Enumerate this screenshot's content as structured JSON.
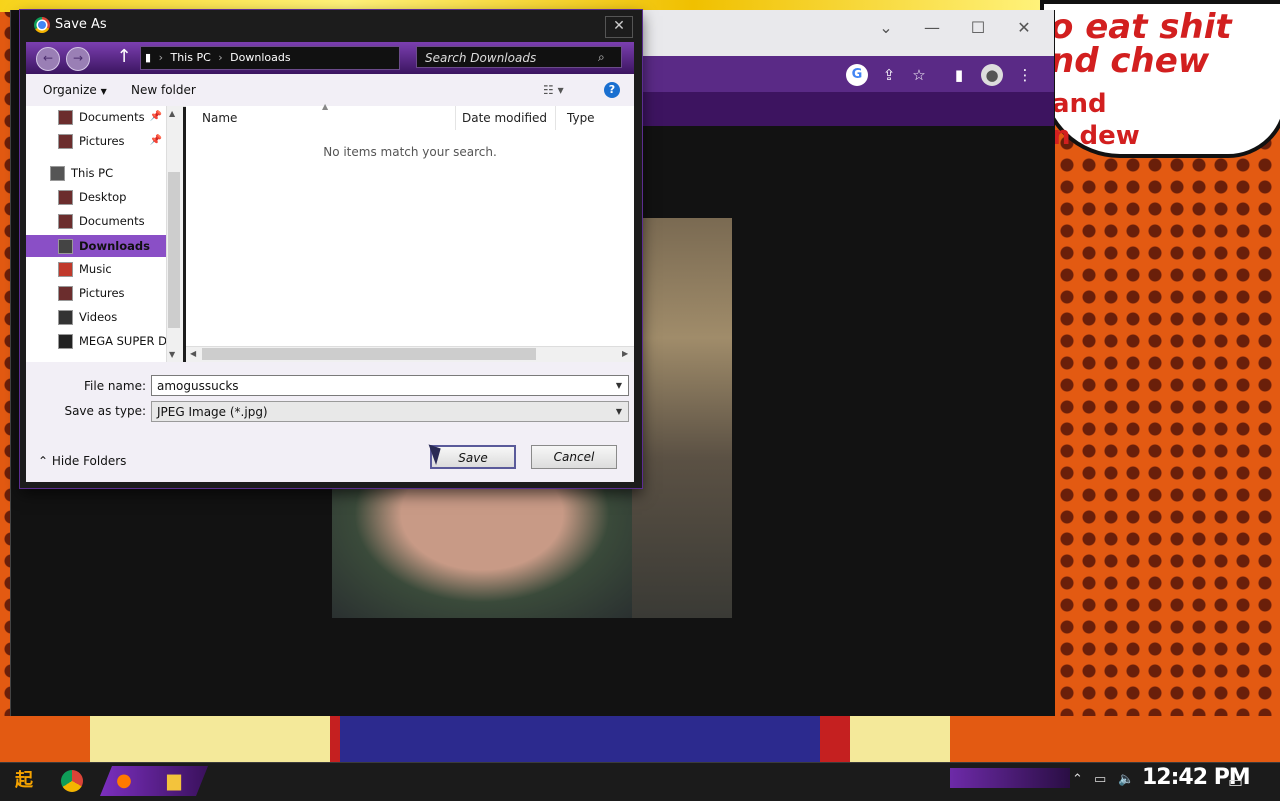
{
  "background": {
    "speech_bubble_lines": [
      "o eat shit",
      "nd chew"
    ],
    "speech_bubble_lines_back": [
      "and",
      "n dew"
    ]
  },
  "browser": {
    "window_controls": {
      "minimize": "—",
      "maximize": "☐",
      "close": "✕",
      "tab_menu": "⌄"
    },
    "toolbar_icons": [
      "google-icon",
      "share-icon",
      "star-icon",
      "sidebar-icon",
      "profile-icon",
      "menu-icon"
    ]
  },
  "dialog": {
    "title": "Save As",
    "close_label": "✕",
    "address": {
      "segments": [
        "This PC",
        "Downloads"
      ]
    },
    "search_placeholder": "Search Downloads",
    "commands": {
      "organize": "Organize",
      "new_folder": "New folder"
    },
    "nav_pane": [
      {
        "label": "Documents",
        "pinned": true
      },
      {
        "label": "Pictures",
        "pinned": true
      },
      {
        "label": "This PC",
        "pinned": false
      },
      {
        "label": "Desktop",
        "pinned": false
      },
      {
        "label": "Documents",
        "pinned": false
      },
      {
        "label": "Downloads",
        "pinned": false,
        "selected": true
      },
      {
        "label": "Music",
        "pinned": false
      },
      {
        "label": "Pictures",
        "pinned": false
      },
      {
        "label": "Videos",
        "pinned": false
      },
      {
        "label": "MEGA SUPER DU",
        "pinned": false
      }
    ],
    "columns": [
      "Name",
      "Date modified",
      "Type"
    ],
    "empty_message": "No items match your search.",
    "file_name_label": "File name:",
    "file_name_value": "amogussucks",
    "save_as_type_label": "Save as type:",
    "save_as_type_value": "JPEG Image (*.jpg)",
    "save_button": "Save",
    "cancel_button": "Cancel",
    "hide_folders": "Hide Folders"
  },
  "taskbar": {
    "clock": "12:42 PM",
    "apps": [
      "start-icon",
      "chrome-icon",
      "firefox-icon",
      "file-explorer-icon"
    ]
  },
  "colors": {
    "accent_purple": "#5a2a86",
    "selected_nav": "#8a4fc6",
    "bubble_text": "#d21f1f"
  }
}
